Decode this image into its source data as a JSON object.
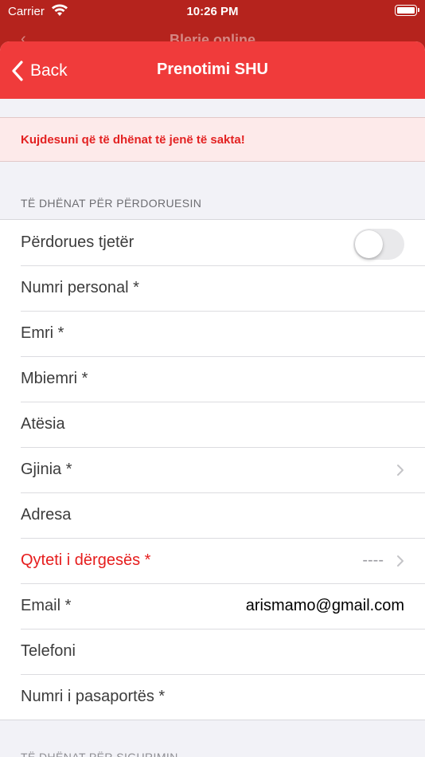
{
  "status_bar": {
    "carrier": "Carrier",
    "time": "10:26 PM"
  },
  "underlying_screen": {
    "title": "Blerje online"
  },
  "nav": {
    "back_label": "Back",
    "title": "Prenotimi SHU"
  },
  "warning": {
    "text": "Kujdesuni që të dhënat të jenë të sakta!"
  },
  "section_user": {
    "header": "TË DHËNAT PËR PËRDORUESIN",
    "rows": [
      {
        "label": "Përdorues tjetër",
        "control": "toggle",
        "toggle_on": false
      },
      {
        "label": "Numri personal *"
      },
      {
        "label": "Emri *"
      },
      {
        "label": "Mbiemri *"
      },
      {
        "label": "Atësia"
      },
      {
        "label": "Gjinia *",
        "chevron": true
      },
      {
        "label": "Adresa"
      },
      {
        "label": "Qyteti i dërgesës *",
        "value": "----",
        "chevron": true,
        "required_highlight": true
      },
      {
        "label": "Email *",
        "value": "arismamo@gmail.com"
      },
      {
        "label": "Telefoni"
      },
      {
        "label": "Numri i pasaportës *"
      }
    ]
  },
  "section_next": {
    "header": "TË DHËNAT PËR SIGURIMIN"
  },
  "colors": {
    "accent": "#f03b3b",
    "warning_text": "#e32222",
    "warning_bg": "#fdeaea"
  }
}
